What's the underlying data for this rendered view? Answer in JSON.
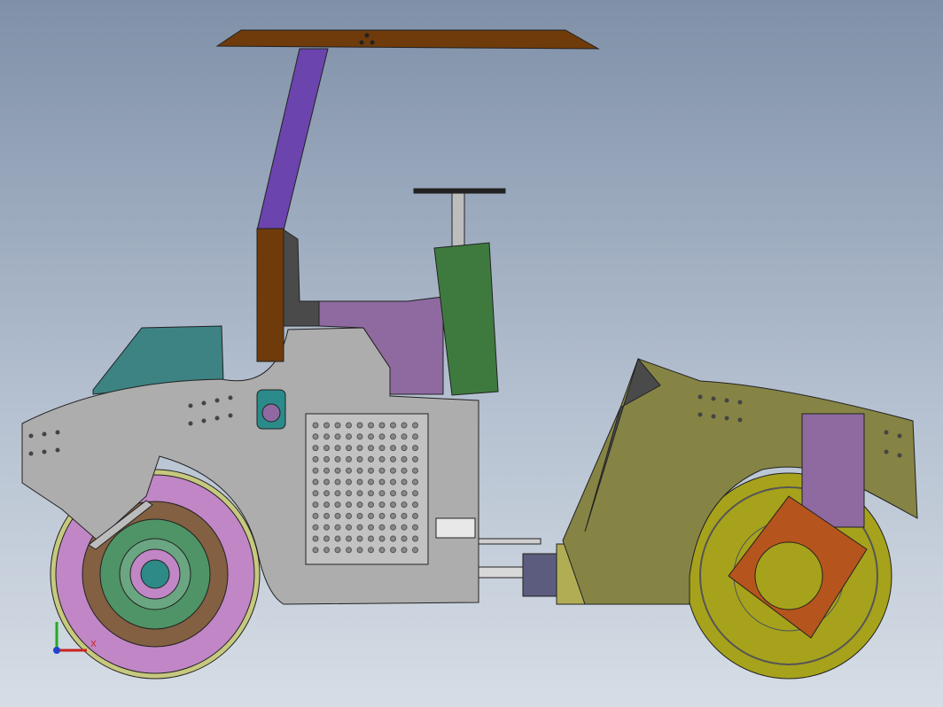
{
  "viewport": {
    "background_top": "#7f90a8",
    "background_bottom": "#d6dde5"
  },
  "model": {
    "subject": "",
    "colors": {
      "canopy": "#6f3b0a",
      "canopy_post": "#6b44ad",
      "seat_back": "#6f3b0a",
      "body": "#adadad",
      "body_panel": "#8e6aa0",
      "steering_column": "#3e7a3e",
      "engine_hood": "#3d8384",
      "rear_frame": "#858445",
      "rear_drum": "#a6a21c",
      "rear_bracket": "#b5541c",
      "front_drum_outer": "#c186c6",
      "front_drum_hub": "#836042",
      "hub_ring": "#4f9466",
      "articulation_joint": "#5c5c7e"
    }
  },
  "triad": {
    "x_label": "X",
    "colors": {
      "x": "#cc2222",
      "y": "#22aa22",
      "z": "#2244cc"
    }
  }
}
